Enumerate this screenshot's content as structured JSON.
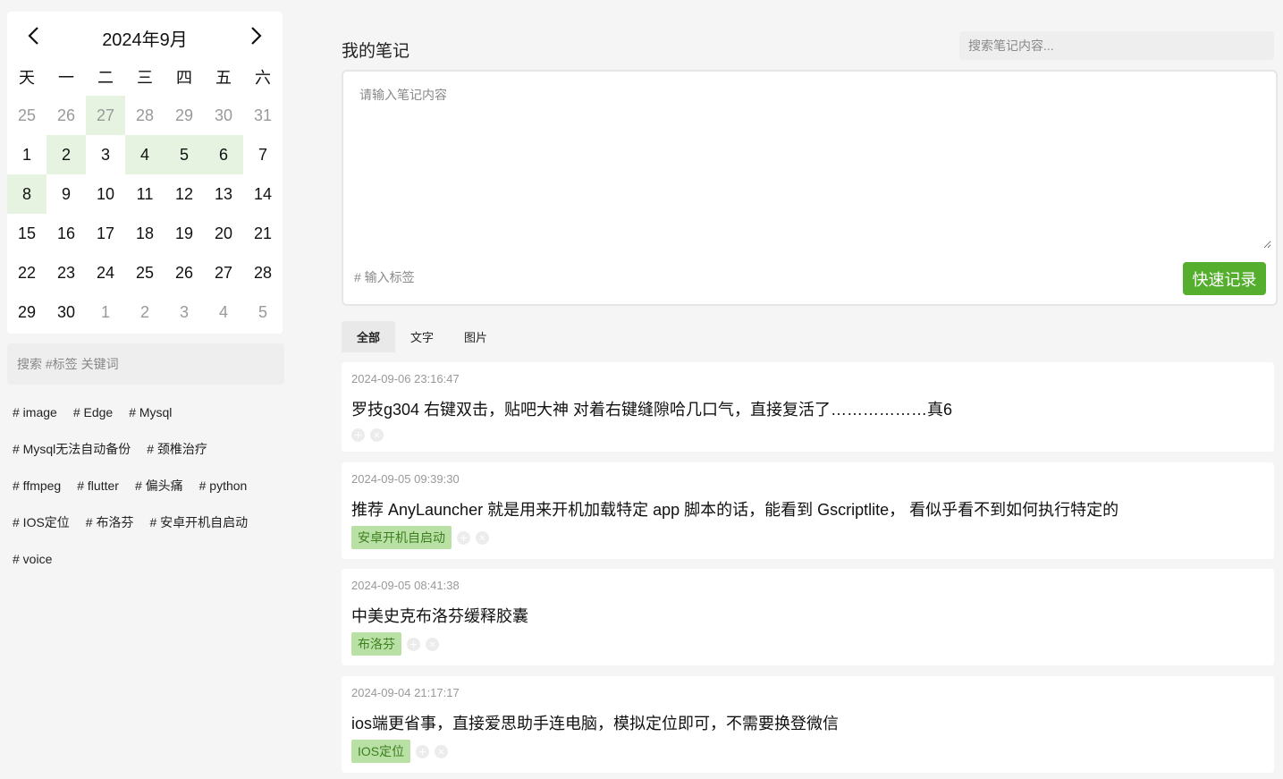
{
  "calendar": {
    "title": "2024年9月",
    "weekdays": [
      "天",
      "一",
      "二",
      "三",
      "四",
      "五",
      "六"
    ],
    "weeks": [
      [
        {
          "d": "25",
          "o": true,
          "m": false
        },
        {
          "d": "26",
          "o": true,
          "m": false
        },
        {
          "d": "27",
          "o": true,
          "m": true
        },
        {
          "d": "28",
          "o": true,
          "m": false
        },
        {
          "d": "29",
          "o": true,
          "m": false
        },
        {
          "d": "30",
          "o": true,
          "m": false
        },
        {
          "d": "31",
          "o": true,
          "m": false
        }
      ],
      [
        {
          "d": "1",
          "o": false,
          "m": false
        },
        {
          "d": "2",
          "o": false,
          "m": true
        },
        {
          "d": "3",
          "o": false,
          "m": false
        },
        {
          "d": "4",
          "o": false,
          "m": true
        },
        {
          "d": "5",
          "o": false,
          "m": true
        },
        {
          "d": "6",
          "o": false,
          "m": true
        },
        {
          "d": "7",
          "o": false,
          "m": false
        }
      ],
      [
        {
          "d": "8",
          "o": false,
          "m": true
        },
        {
          "d": "9",
          "o": false,
          "m": false
        },
        {
          "d": "10",
          "o": false,
          "m": false
        },
        {
          "d": "11",
          "o": false,
          "m": false
        },
        {
          "d": "12",
          "o": false,
          "m": false
        },
        {
          "d": "13",
          "o": false,
          "m": false
        },
        {
          "d": "14",
          "o": false,
          "m": false
        }
      ],
      [
        {
          "d": "15",
          "o": false,
          "m": false
        },
        {
          "d": "16",
          "o": false,
          "m": false
        },
        {
          "d": "17",
          "o": false,
          "m": false
        },
        {
          "d": "18",
          "o": false,
          "m": false
        },
        {
          "d": "19",
          "o": false,
          "m": false
        },
        {
          "d": "20",
          "o": false,
          "m": false
        },
        {
          "d": "21",
          "o": false,
          "m": false
        }
      ],
      [
        {
          "d": "22",
          "o": false,
          "m": false
        },
        {
          "d": "23",
          "o": false,
          "m": false
        },
        {
          "d": "24",
          "o": false,
          "m": false
        },
        {
          "d": "25",
          "o": false,
          "m": false
        },
        {
          "d": "26",
          "o": false,
          "m": false
        },
        {
          "d": "27",
          "o": false,
          "m": false
        },
        {
          "d": "28",
          "o": false,
          "m": false
        }
      ],
      [
        {
          "d": "29",
          "o": false,
          "m": false
        },
        {
          "d": "30",
          "o": false,
          "m": false
        },
        {
          "d": "1",
          "o": true,
          "m": false
        },
        {
          "d": "2",
          "o": true,
          "m": false
        },
        {
          "d": "3",
          "o": true,
          "m": false
        },
        {
          "d": "4",
          "o": true,
          "m": false
        },
        {
          "d": "5",
          "o": true,
          "m": false
        }
      ]
    ],
    "prev_icon": "chevron-left-icon",
    "next_icon": "chevron-right-icon",
    "mark_color": "#e6f3e0"
  },
  "sidebar": {
    "search_placeholder": "搜索 #标签 关键词",
    "tag_lines": [
      [
        "# image",
        "# Edge",
        "# Mysql"
      ],
      [
        "# Mysql无法自动备份",
        "# 颈椎治疗"
      ],
      [
        "# ffmpeg",
        "# flutter",
        "# 偏头痛",
        "# python"
      ],
      [
        "# IOS定位",
        "# 布洛芬",
        "# 安卓开机自启动"
      ],
      [
        "# voice"
      ]
    ]
  },
  "main": {
    "title": "我的笔记",
    "search_placeholder": "搜索笔记内容...",
    "editor": {
      "content_placeholder": "请输入笔记内容",
      "tag_placeholder": "# 输入标签",
      "submit_label": "快速记录"
    },
    "tabs": [
      {
        "label": "全部",
        "active": true
      },
      {
        "label": "文字",
        "active": false
      },
      {
        "label": "图片",
        "active": false
      }
    ],
    "notes": [
      {
        "time": "2024-09-06 23:16:47",
        "text": "罗技g304 右键双击，贴吧大神 对着右键缝隙哈几口气，直接复活了………………真6",
        "tags": []
      },
      {
        "time": "2024-09-05 09:39:30",
        "text": "推荐 AnyLauncher 就是用来开机加载特定 app 脚本的话，能看到 Gscriptlite， 看似乎看不到如何执行特定的",
        "tags": [
          "安卓开机自启动"
        ]
      },
      {
        "time": "2024-09-05 08:41:38",
        "text": "中美史克布洛芬缓释胶囊",
        "tags": [
          "布洛芬"
        ]
      },
      {
        "time": "2024-09-04 21:17:17",
        "text": "ios端更省事，直接爱思助手连电脑，模拟定位即可，不需要换登微信",
        "tags": [
          "IOS定位"
        ]
      }
    ],
    "icons": {
      "add": "plus-icon",
      "remove": "close-icon"
    }
  },
  "colors": {
    "accent": "#56ae2e",
    "tag_bg": "#b9e0a5",
    "tag_text": "#3d7f1f"
  }
}
